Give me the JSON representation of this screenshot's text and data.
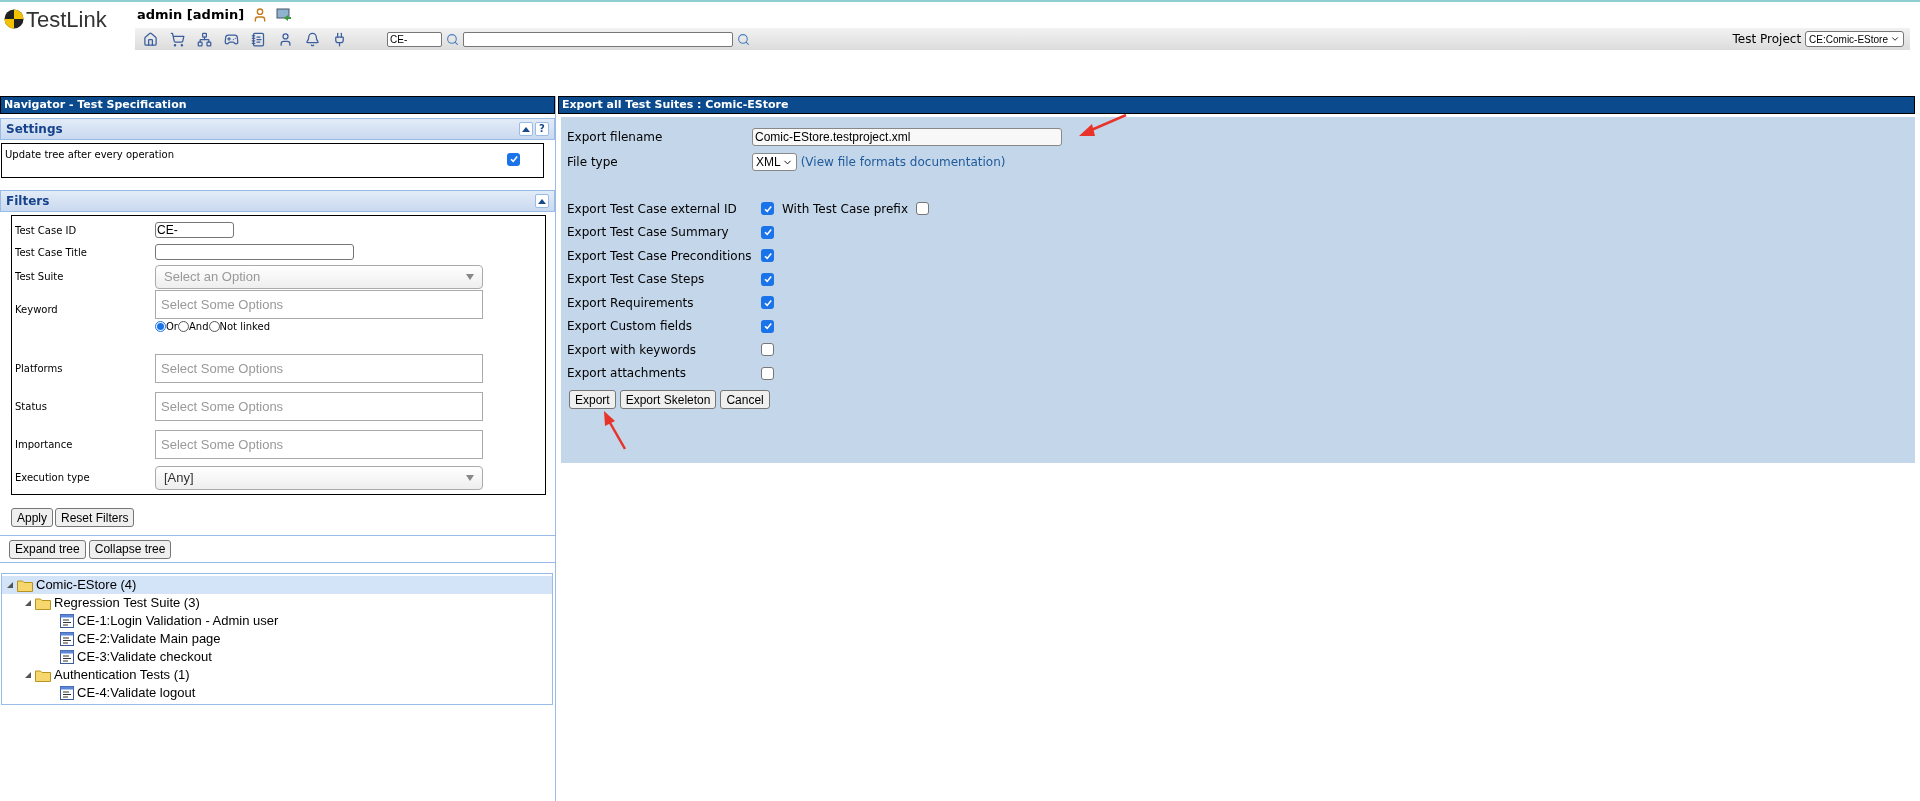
{
  "header": {
    "logo": "TestLink",
    "user": "admin [admin]",
    "search_id": "CE-",
    "project_label": "Test Project",
    "project_value": "CE:Comic-EStore"
  },
  "navigator": {
    "title": "Navigator - Test Specification",
    "settings": {
      "title": "Settings",
      "help": "?",
      "option": "Update tree after every operation",
      "checked": true
    },
    "filters": {
      "title": "Filters",
      "fields": [
        {
          "label": "Test Case ID",
          "kind": "text",
          "value": "CE-"
        },
        {
          "label": "Test Case Title",
          "kind": "wide-text"
        },
        {
          "label": "Test Suite",
          "kind": "select",
          "placeholder": "Select an Option"
        },
        {
          "label": "Keyword",
          "kind": "multi",
          "placeholder": "Select Some Options",
          "options": [
            {
              "label": "Or",
              "selected": true
            },
            {
              "label": "And",
              "selected": false
            },
            {
              "label": "Not linked",
              "selected": false
            }
          ]
        },
        {
          "label": "Platforms",
          "kind": "multi",
          "placeholder": "Select Some Options"
        },
        {
          "label": "Status",
          "kind": "multi",
          "placeholder": "Select Some Options"
        },
        {
          "label": "Importance",
          "kind": "multi",
          "placeholder": "Select Some Options"
        },
        {
          "label": "Execution type",
          "kind": "select",
          "value": "[Any]"
        }
      ],
      "buttons": [
        "Apply",
        "Reset Filters"
      ]
    },
    "tree_buttons": [
      "Expand tree",
      "Collapse tree"
    ],
    "tree": [
      {
        "label": "Comic-EStore (4)",
        "kind": "project",
        "selected": true,
        "children": [
          {
            "label": "Regression Test Suite (3)",
            "kind": "suite",
            "selected": false,
            "children": [
              {
                "label": "CE-1:Login Validation - Admin user",
                "kind": "case",
                "selected": false
              },
              {
                "label": "CE-2:Validate Main page",
                "kind": "case",
                "selected": false
              },
              {
                "label": "CE-3:Validate checkout",
                "kind": "case",
                "selected": false
              }
            ]
          },
          {
            "label": "Authentication Tests (1)",
            "kind": "suite",
            "selected": false,
            "children": [
              {
                "label": "CE-4:Validate logout",
                "kind": "case",
                "selected": false
              }
            ]
          }
        ]
      }
    ]
  },
  "export": {
    "title": "Export all Test Suites : Comic-EStore",
    "filename_label": "Export filename",
    "filename": "Comic-EStore.testproject.xml",
    "filetype_label": "File type",
    "filetype": "XML",
    "doc_link": "(View file formats documentation)",
    "options": [
      {
        "label": "Export Test Case external ID",
        "checked": true,
        "extra": {
          "label": "With Test Case prefix",
          "checked": false
        }
      },
      {
        "label": "Export Test Case Summary",
        "checked": true
      },
      {
        "label": "Export Test Case Preconditions",
        "checked": true
      },
      {
        "label": "Export Test Case Steps",
        "checked": true
      },
      {
        "label": "Export Requirements",
        "checked": true
      },
      {
        "label": "Export Custom fields",
        "checked": true
      },
      {
        "label": "Export with keywords",
        "checked": false
      },
      {
        "label": "Export attachments",
        "checked": false
      }
    ],
    "buttons": [
      "Export",
      "Export Skeleton",
      "Cancel"
    ]
  }
}
